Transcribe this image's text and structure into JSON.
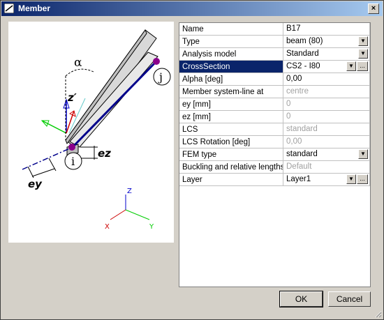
{
  "window": {
    "title": "Member",
    "close_label": "×"
  },
  "preview": {
    "labels": {
      "alpha": "α",
      "zprime": "z′",
      "j": "j",
      "i": "i",
      "ez": "ez",
      "ey": "ey"
    },
    "axes": {
      "z": "Z",
      "x": "X",
      "y": "Y"
    }
  },
  "properties": [
    {
      "label": "Name",
      "value": "B17"
    },
    {
      "label": "Type",
      "value": "beam (80)",
      "dropdown": true
    },
    {
      "label": "Analysis model",
      "value": "Standard",
      "dropdown": true
    },
    {
      "label": "CrossSection",
      "value": "CS2 - I80",
      "dropdown": true,
      "dots": true,
      "selected": true
    },
    {
      "label": "Alpha [deg]",
      "value": "0,00"
    },
    {
      "label": "Member system-line at",
      "value": "centre",
      "disabled": true
    },
    {
      "label": "ey [mm]",
      "value": "0",
      "disabled": true
    },
    {
      "label": "ez [mm]",
      "value": "0",
      "disabled": true
    },
    {
      "label": "LCS",
      "value": "standard",
      "disabled": true
    },
    {
      "label": "LCS Rotation [deg]",
      "value": "0,00",
      "disabled": true
    },
    {
      "label": "FEM type",
      "value": "standard",
      "dropdown": true
    },
    {
      "label": "Buckling and relative lengths",
      "value": "Default",
      "disabled": true
    },
    {
      "label": "Layer",
      "value": "Layer1",
      "dropdown": true,
      "dots": true
    }
  ],
  "buttons": {
    "ok": "OK",
    "cancel": "Cancel"
  }
}
